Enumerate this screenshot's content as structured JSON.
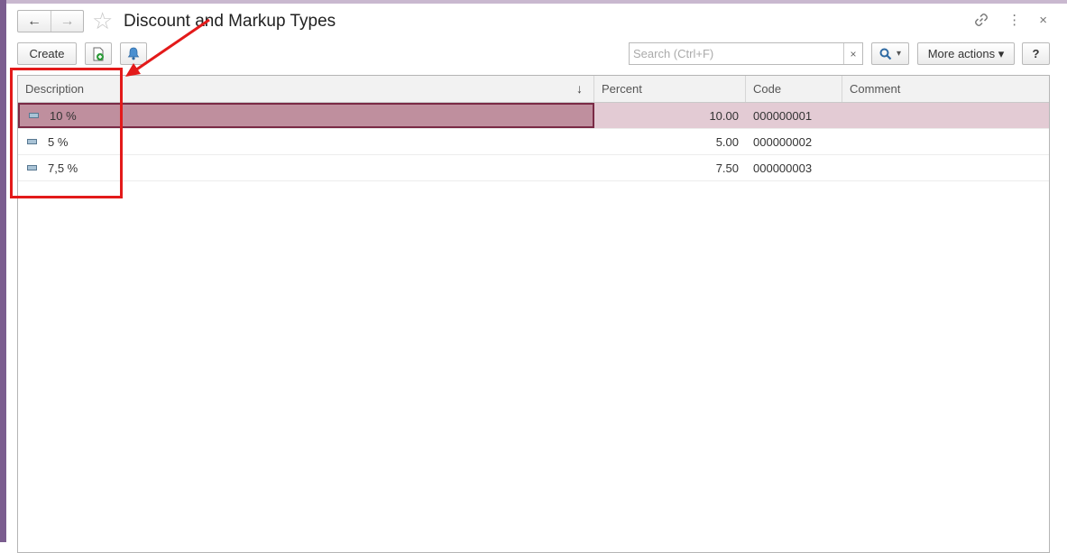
{
  "window": {
    "title": "Discount and Markup Types",
    "back_icon": "←",
    "forward_icon": "→",
    "star_icon": "☆",
    "menu_icon": "⋮",
    "close_icon": "×"
  },
  "toolbar": {
    "create_label": "Create",
    "search_placeholder": "Search (Ctrl+F)",
    "search_clear": "×",
    "search_dropdown": "▾",
    "more_actions_label": "More actions ▾",
    "help_label": "?"
  },
  "table": {
    "headers": {
      "description": "Description",
      "percent": "Percent",
      "code": "Code",
      "comment": "Comment"
    },
    "sort_indicator": "↓",
    "rows": [
      {
        "description": "10 %",
        "percent": "10.00",
        "code": "000000001",
        "comment": ""
      },
      {
        "description": "5 %",
        "percent": "5.00",
        "code": "000000002",
        "comment": ""
      },
      {
        "description": "7,5 %",
        "percent": "7.50",
        "code": "000000003",
        "comment": ""
      }
    ]
  },
  "colors": {
    "selected_row": "#e3cbd4",
    "selected_cell": "#bf8f9e",
    "annotation": "#e31a1a",
    "left_strip": "#7b5d8f"
  }
}
